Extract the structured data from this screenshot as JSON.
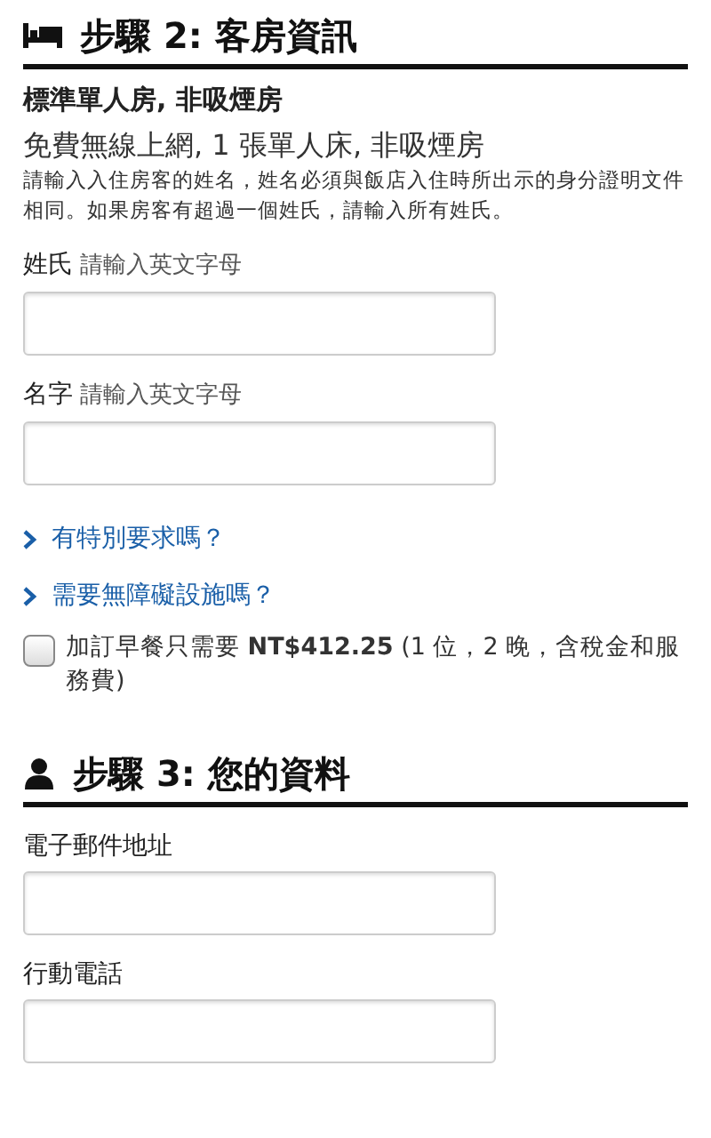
{
  "sections": [
    {
      "kind": "bed",
      "title": "步驟 2: 客房資訊",
      "room_name": "標準單人房, 非吸煙房",
      "room_description": "免費無線上網, 1 張單人床, 非吸煙房",
      "note": "請輸入入住房客的姓名，姓名必須與飯店入住時所出示的身分證明文件相同。如果房客有超過一個姓氏，請輸入所有姓氏。",
      "fields": [
        {
          "label": "姓氏",
          "hint": "請輸入英文字母"
        },
        {
          "label": "名字",
          "hint": "請輸入英文字母"
        }
      ],
      "links": [
        "有特別要求嗎？",
        "需要無障礙設施嗎？"
      ],
      "option": {
        "text": "加訂早餐只需要 **NT$412.25** (1 位，2 晚，含稅金和服務費)",
        "checked": false
      }
    },
    {
      "kind": "person",
      "title": "步驟 3: 您的資料",
      "fields": [
        {
          "label": "電子郵件地址"
        },
        {
          "label": "行動電話"
        }
      ]
    }
  ]
}
